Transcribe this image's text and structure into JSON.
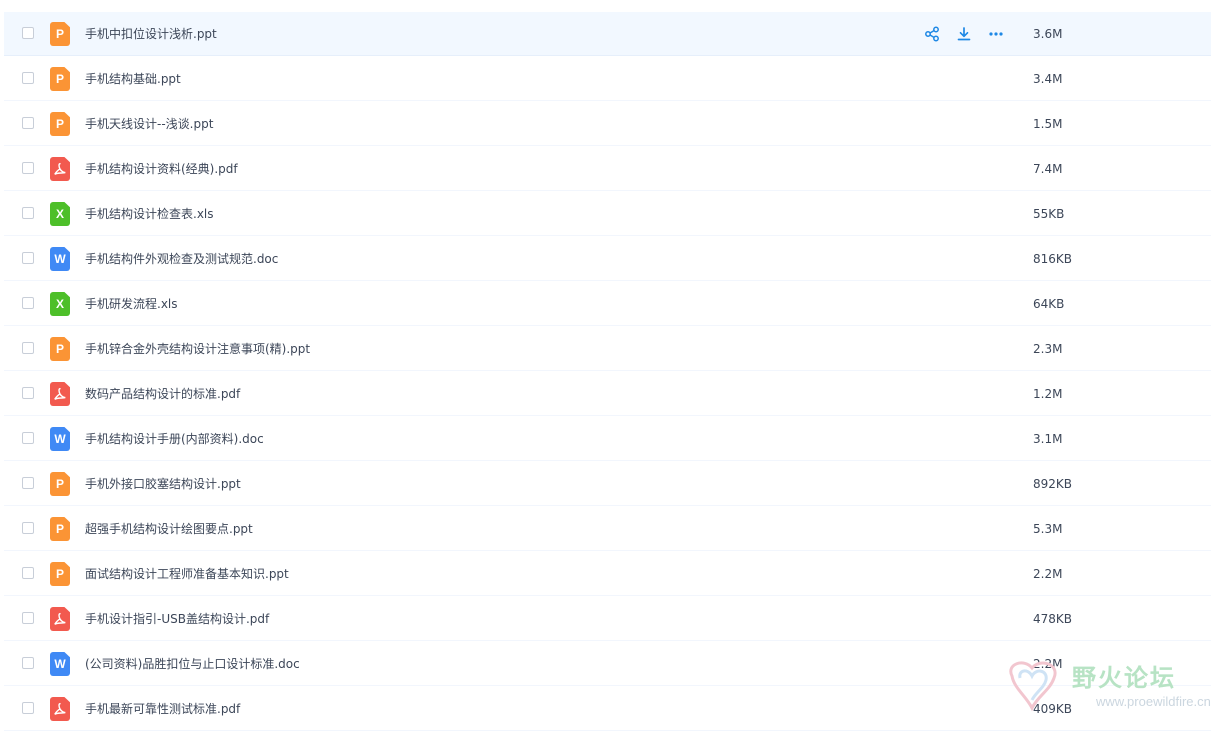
{
  "files": [
    {
      "name": "手机中扣位设计浅析.ppt",
      "size": "3.6M",
      "type": "ppt",
      "hover": true
    },
    {
      "name": "手机结构基础.ppt",
      "size": "3.4M",
      "type": "ppt"
    },
    {
      "name": "手机天线设计--浅谈.ppt",
      "size": "1.5M",
      "type": "ppt"
    },
    {
      "name": "手机结构设计资料(经典).pdf",
      "size": "7.4M",
      "type": "pdf"
    },
    {
      "name": "手机结构设计检查表.xls",
      "size": "55KB",
      "type": "xls"
    },
    {
      "name": "手机结构件外观检查及测试规范.doc",
      "size": "816KB",
      "type": "doc"
    },
    {
      "name": "手机研发流程.xls",
      "size": "64KB",
      "type": "xls"
    },
    {
      "name": "手机锌合金外壳结构设计注意事项(精).ppt",
      "size": "2.3M",
      "type": "ppt"
    },
    {
      "name": "数码产品结构设计的标准.pdf",
      "size": "1.2M",
      "type": "pdf"
    },
    {
      "name": "手机结构设计手册(内部资料).doc",
      "size": "3.1M",
      "type": "doc"
    },
    {
      "name": "手机外接口胶塞结构设计.ppt",
      "size": "892KB",
      "type": "ppt"
    },
    {
      "name": "超强手机结构设计绘图要点.ppt",
      "size": "5.3M",
      "type": "ppt"
    },
    {
      "name": "面试结构设计工程师准备基本知识.ppt",
      "size": "2.2M",
      "type": "ppt"
    },
    {
      "name": "手机设计指引-USB盖结构设计.pdf",
      "size": "478KB",
      "type": "pdf"
    },
    {
      "name": "(公司资料)品胜扣位与止口设计标准.doc",
      "size": "2.2M",
      "type": "doc"
    },
    {
      "name": "手机最新可靠性测试标准.pdf",
      "size": "409KB",
      "type": "pdf"
    }
  ],
  "icon_letters": {
    "ppt": "P",
    "xls": "X",
    "doc": "W"
  },
  "row_actions": [
    {
      "icon": "share-icon"
    },
    {
      "icon": "download-icon"
    },
    {
      "icon": "more-icon"
    }
  ],
  "colors": {
    "accent": "#1e88e5",
    "ppt": "#fb9435",
    "pdf": "#f25a4f",
    "xls": "#4dbf29",
    "doc": "#3f89f5"
  },
  "watermark": {
    "title": "野火论坛",
    "url": "www.proewildfire.cn"
  }
}
